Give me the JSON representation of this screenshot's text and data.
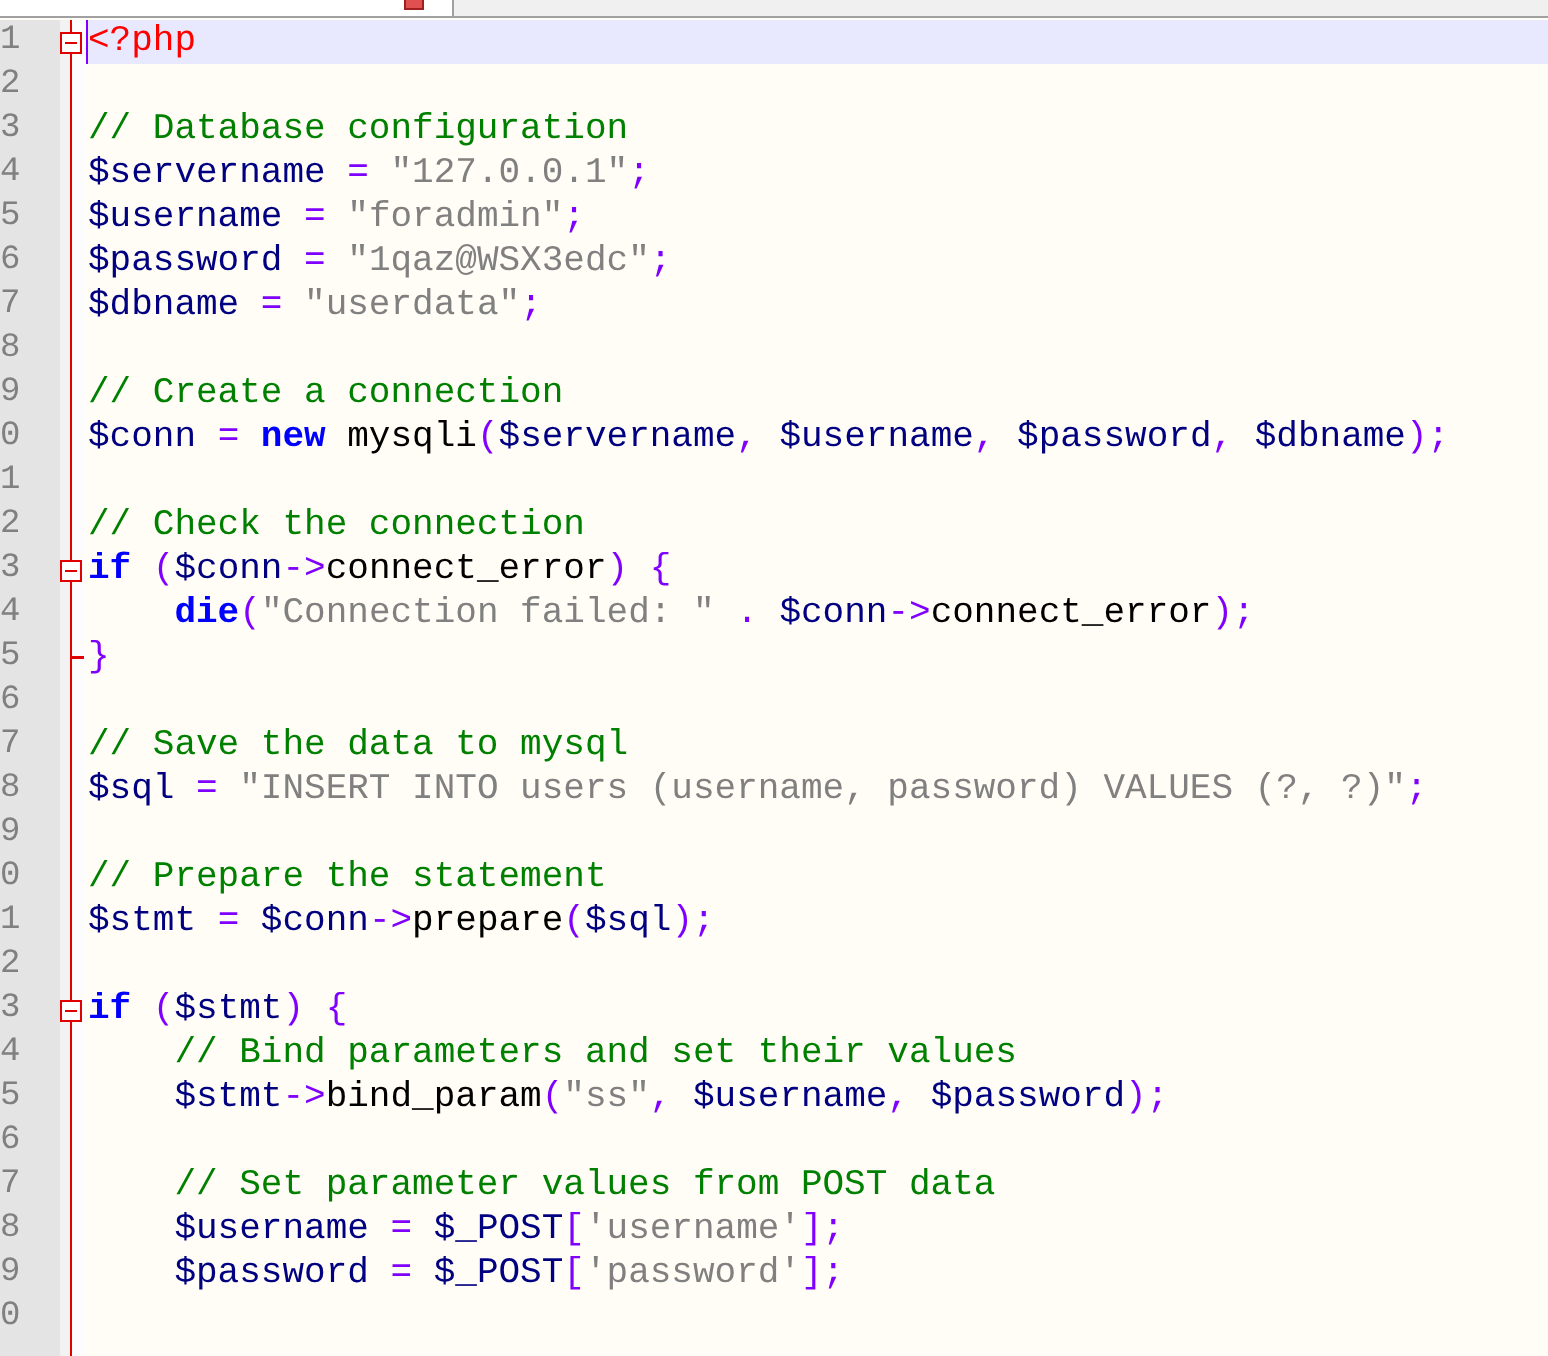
{
  "lines": [
    {
      "number": "1",
      "fold_open": true,
      "fold_end": false,
      "current": true,
      "tokens": [
        {
          "kind": "tag",
          "text": "<?php"
        }
      ]
    },
    {
      "number": "2",
      "fold_open": false,
      "fold_end": false,
      "current": false
    },
    {
      "number": "3",
      "fold_open": false,
      "fold_end": false,
      "current": false,
      "tokens": [
        {
          "kind": "comment",
          "text": "// Database configuration"
        }
      ]
    },
    {
      "number": "4",
      "fold_open": false,
      "fold_end": false,
      "current": false,
      "tokens": [
        {
          "kind": "var",
          "text": "$servername "
        },
        {
          "kind": "op",
          "text": "= "
        },
        {
          "kind": "str",
          "text": "\"127.0.0.1\""
        },
        {
          "kind": "op",
          "text": ";"
        }
      ]
    },
    {
      "number": "5",
      "fold_open": false,
      "fold_end": false,
      "current": false,
      "tokens": [
        {
          "kind": "var",
          "text": "$username "
        },
        {
          "kind": "op",
          "text": "= "
        },
        {
          "kind": "str",
          "text": "\"foradmin\""
        },
        {
          "kind": "op",
          "text": ";"
        }
      ]
    },
    {
      "number": "6",
      "fold_open": false,
      "fold_end": false,
      "current": false,
      "tokens": [
        {
          "kind": "var",
          "text": "$password "
        },
        {
          "kind": "op",
          "text": "= "
        },
        {
          "kind": "str",
          "text": "\"1qaz@WSX3edc\""
        },
        {
          "kind": "op",
          "text": ";"
        }
      ]
    },
    {
      "number": "7",
      "fold_open": false,
      "fold_end": false,
      "current": false,
      "tokens": [
        {
          "kind": "var",
          "text": "$dbname "
        },
        {
          "kind": "op",
          "text": "= "
        },
        {
          "kind": "str",
          "text": "\"userdata\""
        },
        {
          "kind": "op",
          "text": ";"
        }
      ]
    },
    {
      "number": "8",
      "fold_open": false,
      "fold_end": false,
      "current": false
    },
    {
      "number": "9",
      "fold_open": false,
      "fold_end": false,
      "current": false,
      "tokens": [
        {
          "kind": "comment",
          "text": "// Create a connection"
        }
      ]
    },
    {
      "number": "0",
      "fold_open": false,
      "fold_end": false,
      "current": false,
      "tokens": [
        {
          "kind": "var",
          "text": "$conn "
        },
        {
          "kind": "op",
          "text": "= "
        },
        {
          "kind": "kw",
          "text": "new"
        },
        {
          "kind": "plain",
          "text": " mysqli"
        },
        {
          "kind": "op",
          "text": "("
        },
        {
          "kind": "var",
          "text": "$servername"
        },
        {
          "kind": "op",
          "text": ", "
        },
        {
          "kind": "var",
          "text": "$username"
        },
        {
          "kind": "op",
          "text": ", "
        },
        {
          "kind": "var",
          "text": "$password"
        },
        {
          "kind": "op",
          "text": ", "
        },
        {
          "kind": "var",
          "text": "$dbname"
        },
        {
          "kind": "op",
          "text": ");"
        }
      ]
    },
    {
      "number": "1",
      "fold_open": false,
      "fold_end": false,
      "current": false
    },
    {
      "number": "2",
      "fold_open": false,
      "fold_end": false,
      "current": false,
      "tokens": [
        {
          "kind": "comment",
          "text": "// Check the connection"
        }
      ]
    },
    {
      "number": "3",
      "fold_open": true,
      "fold_end": false,
      "current": false,
      "tokens": [
        {
          "kind": "kw",
          "text": "if"
        },
        {
          "kind": "op",
          "text": " ("
        },
        {
          "kind": "var",
          "text": "$conn"
        },
        {
          "kind": "op",
          "text": "->"
        },
        {
          "kind": "plain",
          "text": "connect_error"
        },
        {
          "kind": "op",
          "text": ") {"
        }
      ]
    },
    {
      "number": "4",
      "fold_open": false,
      "fold_end": false,
      "current": false,
      "tokens": [
        {
          "kind": "kw",
          "text": "    die"
        },
        {
          "kind": "op",
          "text": "("
        },
        {
          "kind": "str",
          "text": "\"Connection failed: \""
        },
        {
          "kind": "op",
          "text": " . "
        },
        {
          "kind": "var",
          "text": "$conn"
        },
        {
          "kind": "op",
          "text": "->"
        },
        {
          "kind": "plain",
          "text": "connect_error"
        },
        {
          "kind": "op",
          "text": ");"
        }
      ]
    },
    {
      "number": "5",
      "fold_open": false,
      "fold_end": true,
      "current": false,
      "tokens": [
        {
          "kind": "op",
          "text": "}"
        }
      ]
    },
    {
      "number": "6",
      "fold_open": false,
      "fold_end": false,
      "current": false
    },
    {
      "number": "7",
      "fold_open": false,
      "fold_end": false,
      "current": false,
      "tokens": [
        {
          "kind": "comment",
          "text": "// Save the data to mysql"
        }
      ]
    },
    {
      "number": "8",
      "fold_open": false,
      "fold_end": false,
      "current": false,
      "tokens": [
        {
          "kind": "var",
          "text": "$sql "
        },
        {
          "kind": "op",
          "text": "= "
        },
        {
          "kind": "str",
          "text": "\"INSERT INTO users (username, password) VALUES (?, ?)\""
        },
        {
          "kind": "op",
          "text": ";"
        }
      ]
    },
    {
      "number": "9",
      "fold_open": false,
      "fold_end": false,
      "current": false
    },
    {
      "number": "0",
      "fold_open": false,
      "fold_end": false,
      "current": false,
      "tokens": [
        {
          "kind": "comment",
          "text": "// Prepare the statement"
        }
      ]
    },
    {
      "number": "1",
      "fold_open": false,
      "fold_end": false,
      "current": false,
      "tokens": [
        {
          "kind": "var",
          "text": "$stmt "
        },
        {
          "kind": "op",
          "text": "= "
        },
        {
          "kind": "var",
          "text": "$conn"
        },
        {
          "kind": "op",
          "text": "->"
        },
        {
          "kind": "plain",
          "text": "prepare"
        },
        {
          "kind": "op",
          "text": "("
        },
        {
          "kind": "var",
          "text": "$sql"
        },
        {
          "kind": "op",
          "text": ");"
        }
      ]
    },
    {
      "number": "2",
      "fold_open": false,
      "fold_end": false,
      "current": false
    },
    {
      "number": "3",
      "fold_open": true,
      "fold_end": false,
      "current": false,
      "tokens": [
        {
          "kind": "kw",
          "text": "if"
        },
        {
          "kind": "op",
          "text": " ("
        },
        {
          "kind": "var",
          "text": "$stmt"
        },
        {
          "kind": "op",
          "text": ") {"
        }
      ]
    },
    {
      "number": "4",
      "fold_open": false,
      "fold_end": false,
      "current": false,
      "tokens": [
        {
          "kind": "comment",
          "text": "    // Bind parameters and set their values"
        }
      ]
    },
    {
      "number": "5",
      "fold_open": false,
      "fold_end": false,
      "current": false,
      "tokens": [
        {
          "kind": "var",
          "text": "    $stmt"
        },
        {
          "kind": "op",
          "text": "->"
        },
        {
          "kind": "plain",
          "text": "bind_param"
        },
        {
          "kind": "op",
          "text": "("
        },
        {
          "kind": "str",
          "text": "\"ss\""
        },
        {
          "kind": "op",
          "text": ", "
        },
        {
          "kind": "var",
          "text": "$username"
        },
        {
          "kind": "op",
          "text": ", "
        },
        {
          "kind": "var",
          "text": "$password"
        },
        {
          "kind": "op",
          "text": ");"
        }
      ]
    },
    {
      "number": "6",
      "fold_open": false,
      "fold_end": false,
      "current": false
    },
    {
      "number": "7",
      "fold_open": false,
      "fold_end": false,
      "current": false,
      "tokens": [
        {
          "kind": "comment",
          "text": "    // Set parameter values from POST data"
        }
      ]
    },
    {
      "number": "8",
      "fold_open": false,
      "fold_end": false,
      "current": false,
      "tokens": [
        {
          "kind": "var",
          "text": "    $username "
        },
        {
          "kind": "op",
          "text": "= "
        },
        {
          "kind": "var",
          "text": "$_POST"
        },
        {
          "kind": "op",
          "text": "["
        },
        {
          "kind": "str",
          "text": "'username'"
        },
        {
          "kind": "op",
          "text": "];"
        }
      ]
    },
    {
      "number": "9",
      "fold_open": false,
      "fold_end": false,
      "current": false,
      "tokens": [
        {
          "kind": "var",
          "text": "    $password "
        },
        {
          "kind": "op",
          "text": "= "
        },
        {
          "kind": "var",
          "text": "$_POST"
        },
        {
          "kind": "op",
          "text": "["
        },
        {
          "kind": "str",
          "text": "'password'"
        },
        {
          "kind": "op",
          "text": "];"
        }
      ]
    },
    {
      "number": "0",
      "fold_open": false,
      "fold_end": false,
      "current": false
    }
  ]
}
